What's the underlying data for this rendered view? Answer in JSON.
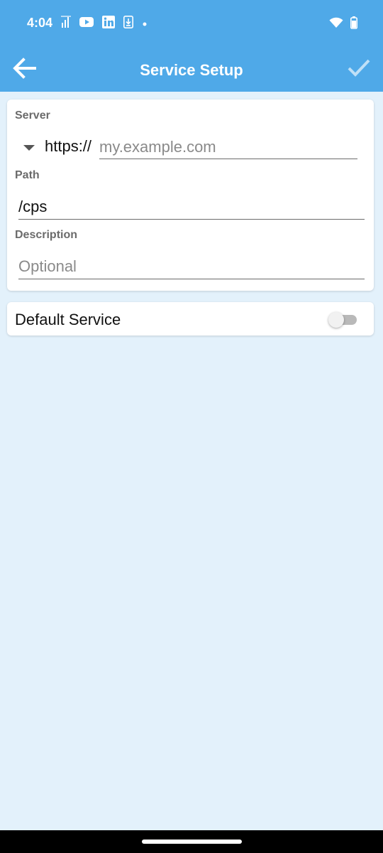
{
  "status_bar": {
    "time": "4:04",
    "left_icons": [
      "signal-icon",
      "youtube-icon",
      "linkedin-icon",
      "download-icon",
      "dot-icon"
    ],
    "right_icons": [
      "wifi-icon",
      "battery-icon"
    ]
  },
  "app_bar": {
    "title": "Service Setup",
    "back_icon": "arrow-left-icon",
    "confirm_icon": "check-icon"
  },
  "form": {
    "server_label": "Server",
    "scheme": "https://",
    "host_value": "",
    "host_placeholder": "my.example.com",
    "path_label": "Path",
    "path_value": "/cps",
    "description_label": "Description",
    "description_value": "",
    "description_placeholder": "Optional"
  },
  "default_service": {
    "label": "Default Service",
    "enabled": false
  },
  "colors": {
    "app_bar": "#4fa9e8",
    "background": "#e3f1fb",
    "card": "#ffffff"
  }
}
